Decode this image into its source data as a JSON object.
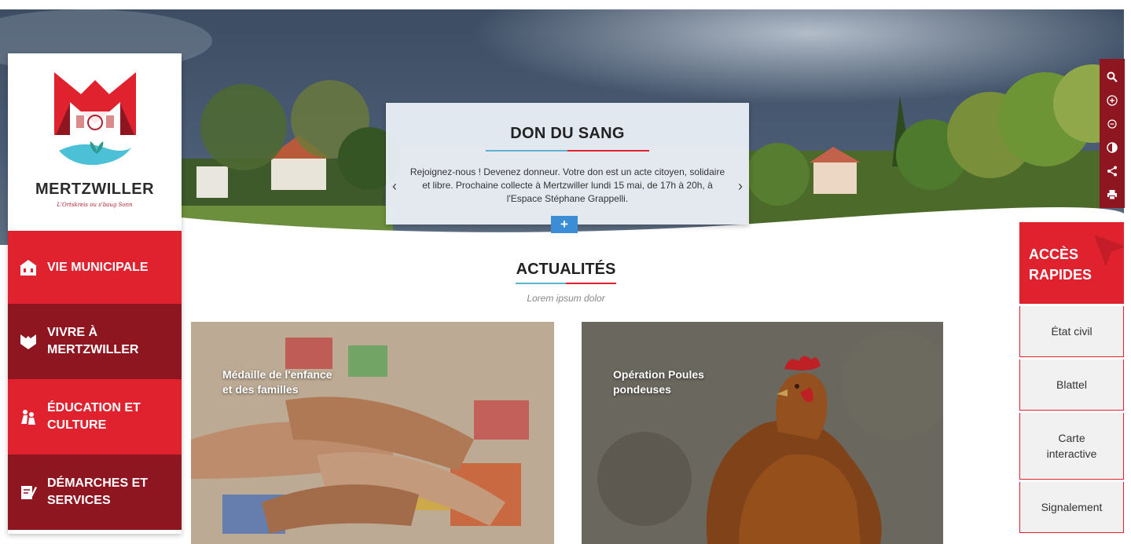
{
  "brand": {
    "name": "MERTZWILLER",
    "tagline": "L'Ortskreis ou s'baug Sonn"
  },
  "colors": {
    "red": "#e0222f",
    "dark_red": "#8e1620",
    "blue": "#5cb3cf",
    "button_blue": "#3b8dd6"
  },
  "nav": {
    "items": [
      {
        "label": "VIE MUNICIPALE",
        "icon": "town-hall-icon"
      },
      {
        "label": "VIVRE À MERTZWILLER",
        "icon": "heart-shield-icon"
      },
      {
        "label": "ÉDUCATION ET CULTURE",
        "icon": "people-icon"
      },
      {
        "label": "DÉMARCHES ET SERVICES",
        "icon": "document-pen-icon"
      }
    ]
  },
  "slider": {
    "title": "DON DU SANG",
    "text": "Rejoignez-nous ! Devenez donneur. Votre don est un acte citoyen, solidaire et libre. Prochaine collecte à Mertzwiller lundi 15 mai, de 17h à 20h, à l'Espace Stéphane Grappelli.",
    "prev": "‹",
    "next": "›",
    "more": "+"
  },
  "tools": [
    "search-icon",
    "zoom-in-icon",
    "zoom-out-icon",
    "contrast-icon",
    "share-icon",
    "print-icon"
  ],
  "news": {
    "title": "ACTUALITÉS",
    "subtitle": "Lorem ipsum dolor",
    "cards": [
      {
        "title": "Médaille de l'enfance et des familles"
      },
      {
        "title": "Opération Poules pondeuses"
      }
    ]
  },
  "quick_access": {
    "title": "ACCÈS RAPIDES",
    "items": [
      "État civil",
      "Blattel",
      "Carte interactive",
      "Signalement"
    ]
  }
}
